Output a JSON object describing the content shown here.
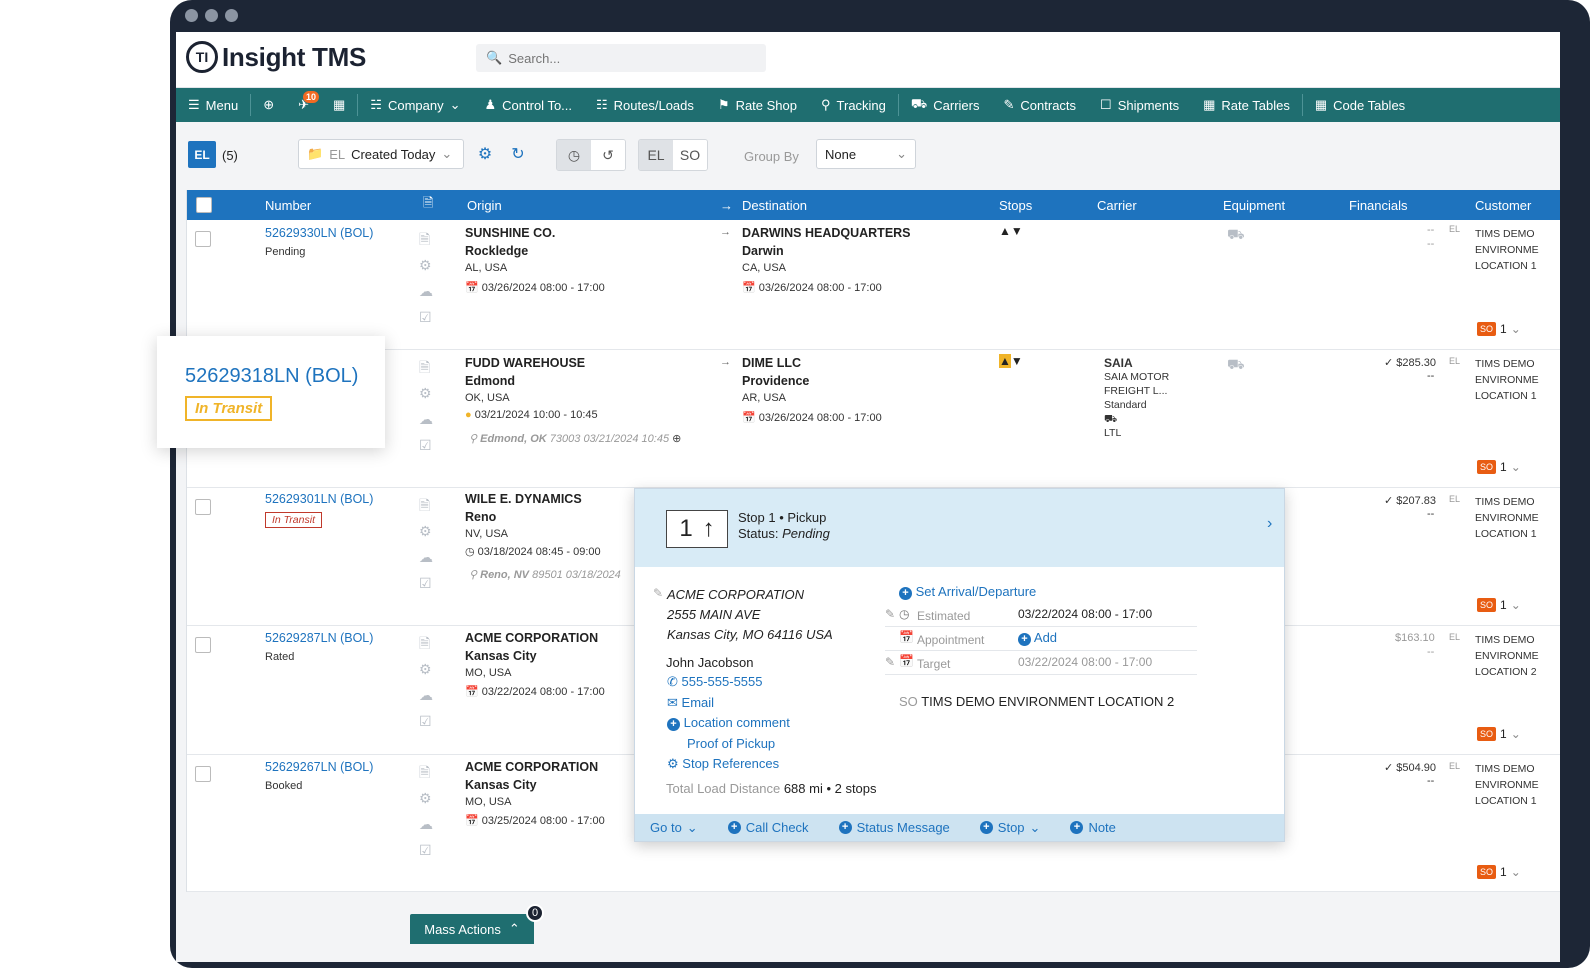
{
  "app": {
    "title": "Insight TMS",
    "logo_mark": "TI"
  },
  "search": {
    "placeholder": "Search..."
  },
  "nav": {
    "menu": "Menu",
    "badge": "10",
    "items": [
      "Company",
      "Control To...",
      "Routes/Loads",
      "Rate Shop",
      "Tracking",
      "Carriers",
      "Contracts",
      "Shipments",
      "Rate Tables",
      "Code Tables"
    ]
  },
  "toolbar": {
    "el": "EL",
    "count": "(5)",
    "filter_prefix": "EL",
    "filter": "Created Today",
    "seg_el": "EL",
    "seg_so": "SO",
    "group_by_label": "Group By",
    "group_by_value": "None"
  },
  "columns": [
    "Number",
    "Origin",
    "Destination",
    "Stops",
    "Carrier",
    "Equipment",
    "Financials",
    "Customer"
  ],
  "rows": [
    {
      "number": "52629330LN (BOL)",
      "status": "Pending",
      "origin": {
        "name": "SUNSHINE CO.",
        "city": "Rockledge",
        "state": "AL, USA",
        "date": "03/26/2024 08:00 - 17:00"
      },
      "dest": {
        "name": "DARWINS HEADQUARTERS",
        "city": "Darwin",
        "state": "CA, USA",
        "date": "03/26/2024 08:00 - 17:00"
      },
      "fin": "--",
      "fin2": "--",
      "cust": [
        "TIMS DEMO",
        "ENVIRONME",
        "LOCATION 1"
      ],
      "so_count": "1"
    },
    {
      "number": "52629318LN (BOL)",
      "status": "In Transit",
      "origin": {
        "name": "FUDD WAREHOUSE",
        "city": "Edmond",
        "state": "OK, USA",
        "date": "03/21/2024 10:00 - 10:45",
        "track": "Edmond, OK",
        "track_zip": "73003 03/21/2024 10:45"
      },
      "dest": {
        "name": "DIME LLC",
        "city": "Providence",
        "state": "AR, USA",
        "date": "03/26/2024 08:00 - 17:00"
      },
      "carrier": [
        "SAIA",
        "SAIA MOTOR",
        "FREIGHT L...",
        "Standard",
        "LTL"
      ],
      "fin": "✓ $285.30",
      "fin2": "--",
      "cust": [
        "TIMS DEMO",
        "ENVIRONME",
        "LOCATION 1"
      ],
      "so_count": "1"
    },
    {
      "number": "52629301LN (BOL)",
      "status": "In Transit",
      "origin": {
        "name": "WILE E. DYNAMICS",
        "city": "Reno",
        "state": "NV, USA",
        "date": "03/18/2024 08:45 - 09:00",
        "track": "Reno, NV",
        "track_zip": "89501 03/18/2024"
      },
      "fin": "✓ $207.83",
      "fin2": "--",
      "cust": [
        "TIMS DEMO",
        "ENVIRONME",
        "LOCATION 1"
      ],
      "so_count": "1"
    },
    {
      "number": "52629287LN (BOL)",
      "status": "Rated",
      "origin": {
        "name": "ACME CORPORATION",
        "city": "Kansas City",
        "state": "MO, USA",
        "date": "03/22/2024 08:00 - 17:00"
      },
      "fin": "$163.10",
      "fin2": "--",
      "cust": [
        "TIMS DEMO",
        "ENVIRONME",
        "LOCATION 2"
      ],
      "so_count": "1"
    },
    {
      "number": "52629267LN (BOL)",
      "status": "Booked",
      "origin": {
        "name": "ACME CORPORATION",
        "city": "Kansas City",
        "state": "MO, USA",
        "date": "03/25/2024 08:00 - 17:00"
      },
      "fin": "✓ $504.90",
      "fin2": "--",
      "cust": [
        "TIMS DEMO",
        "ENVIRONME",
        "LOCATION 1"
      ],
      "so_count": "1"
    }
  ],
  "fin_tag": "EL",
  "so_tag": "SO",
  "popover": {
    "stop_num": "1",
    "stop_title": "Stop 1 • Pickup",
    "status_label": "Status:",
    "status": "Pending",
    "company": "ACME CORPORATION",
    "address1": "2555 MAIN AVE",
    "address2": "Kansas City, MO 64116 USA",
    "contact": "John Jacobson",
    "phone": "555-555-5555",
    "email": "Email",
    "location_comment": "Location comment",
    "proof": "Proof of Pickup",
    "stop_refs": "Stop References",
    "distance_label": "Total Load Distance",
    "distance": "688 mi • 2 stops",
    "set_arrival": "Set Arrival/Departure",
    "estimated_label": "Estimated",
    "estimated": "03/22/2024 08:00 - 17:00",
    "appointment_label": "Appointment",
    "add": "Add",
    "target_label": "Target",
    "target": "03/22/2024 08:00 - 17:00",
    "so_prefix": "SO",
    "so_location": "TIMS DEMO ENVIRONMENT LOCATION 2",
    "footer": {
      "goto": "Go to",
      "call_check": "Call Check",
      "status_msg": "Status Message",
      "stop": "Stop",
      "note": "Note"
    }
  },
  "callout": {
    "number": "52629318LN (BOL)",
    "status": "In Transit"
  },
  "mass": {
    "label": "Mass Actions",
    "count": "0"
  },
  "colors": {
    "accent": "#1e73be",
    "nav": "#1f6e70",
    "frame": "#1d2636",
    "so": "#e85c12",
    "transit": "#f0b429"
  }
}
